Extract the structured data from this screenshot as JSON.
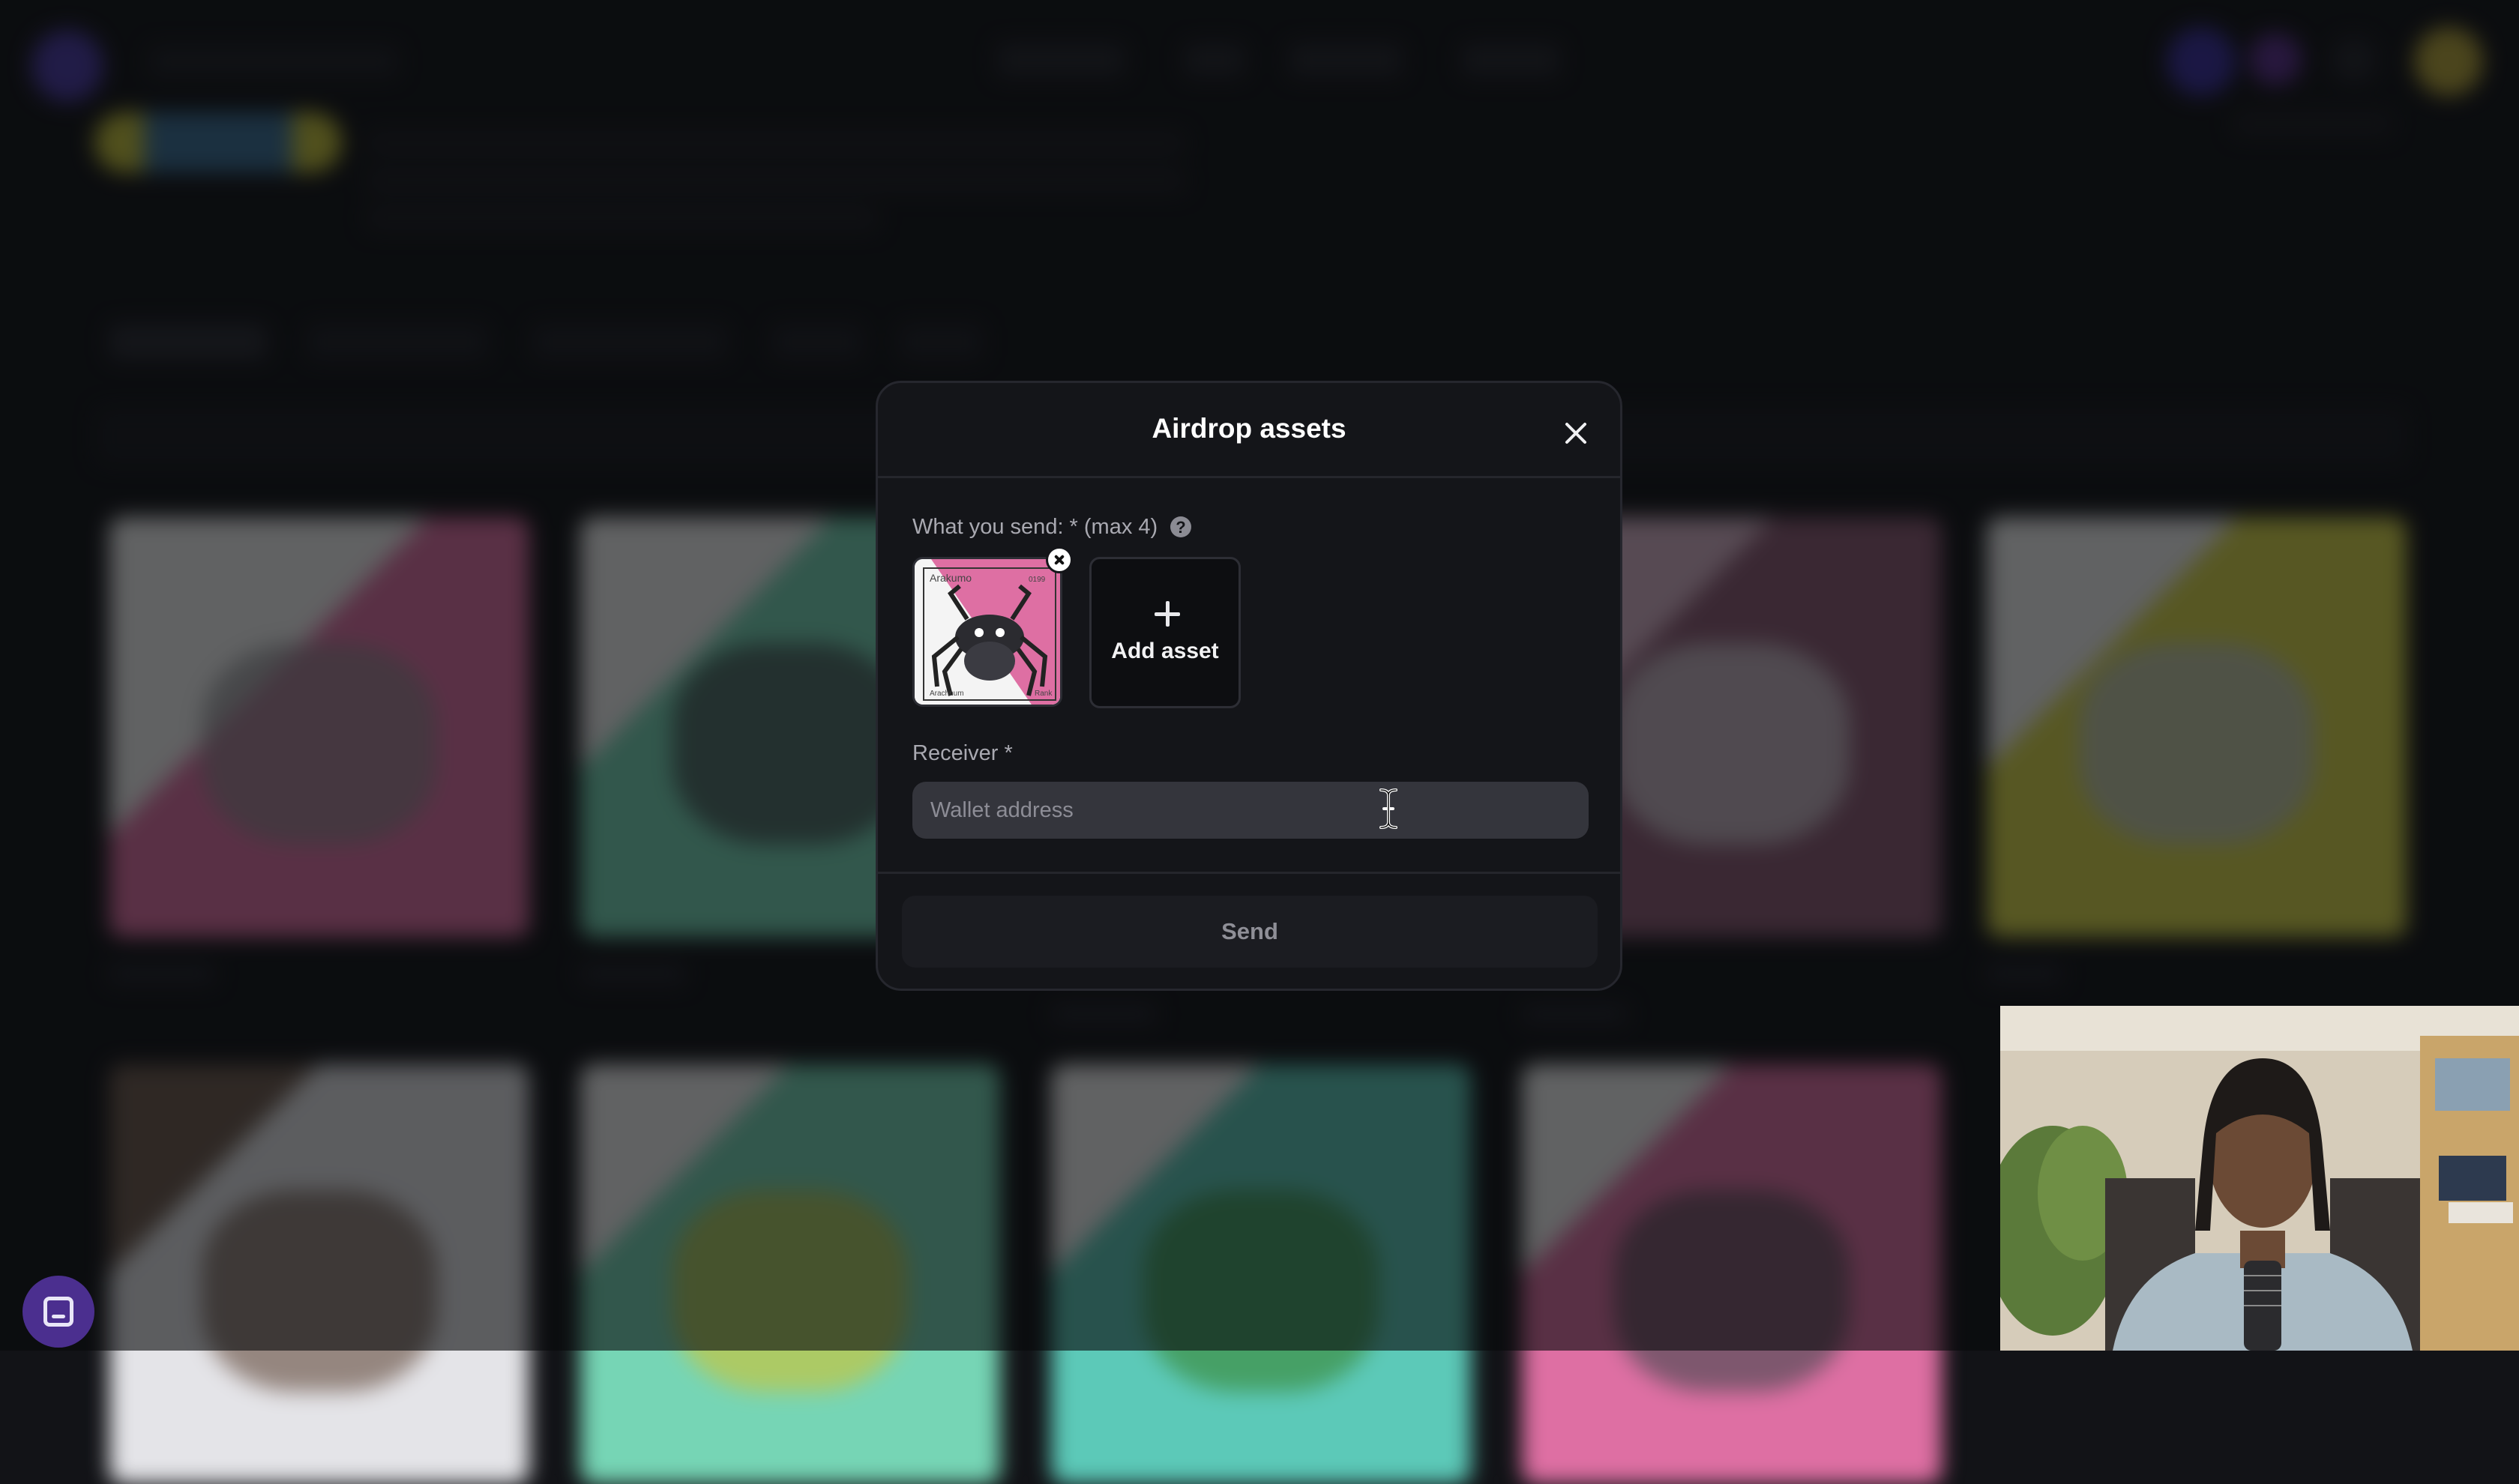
{
  "modal": {
    "title": "Airdrop assets",
    "send_label": "What you send: * (max 4)",
    "help_icon": "?",
    "selected_asset": {
      "name_tag": "Arakumo",
      "number_tag": "0199",
      "footer_left": "Arachnum",
      "footer_right": "Rank"
    },
    "add_asset_label": "Add asset",
    "receiver_label": "Receiver *",
    "wallet_placeholder": "Wallet address",
    "wallet_value": "",
    "send_label_button": "Send"
  },
  "colors": {
    "modal_bg": "#141519",
    "input_bg": "#34353c",
    "accent_purple": "#4b2f8f",
    "card_pink": "#de6fa3",
    "card_green": "#76d5b5",
    "card_yellow": "#d8d64a"
  },
  "icons": {
    "close": "close-icon",
    "help": "help-icon",
    "remove_asset": "close-icon",
    "add": "plus-icon",
    "text_cursor": "text-cursor-icon",
    "chat": "chat-icon"
  }
}
